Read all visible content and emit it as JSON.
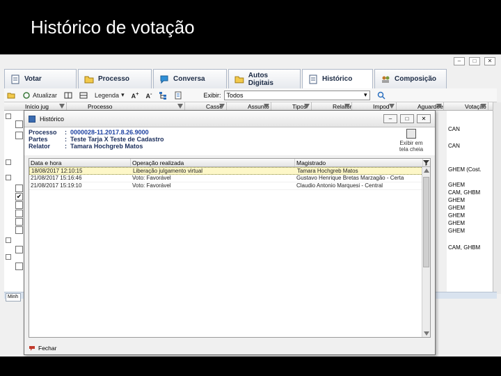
{
  "slide": {
    "title": "Histórico de votação"
  },
  "app": {
    "window_controls": [
      "–",
      "□",
      "✕"
    ],
    "tabs": [
      {
        "label": "Votar",
        "icon": "document-icon"
      },
      {
        "label": "Processo",
        "icon": "folder-icon"
      },
      {
        "label": "Conversa",
        "icon": "chat-bubble-icon"
      },
      {
        "label": "Autos Digitais",
        "icon": "folder-icon"
      },
      {
        "label": "Histórico",
        "icon": "document-icon"
      },
      {
        "label": "Composição",
        "icon": "people-icon"
      }
    ],
    "toolbar": {
      "atualizar": "Atualizar",
      "legenda": "Legenda",
      "exibir_label": "Exibir:",
      "exibir_value": "Todos"
    },
    "grid_columns": [
      "Início jug",
      "Processo",
      "Casse",
      "Assunto",
      "Tipos",
      "Relator",
      "Impod",
      "Aguardeed",
      "Votação"
    ],
    "right_col_values": [
      "CAN",
      "CAN",
      "GHEM (Cost.",
      "GHEM",
      "CAM, GHBM",
      "GHEM",
      "GHEM",
      "GHEM",
      "GHEM",
      "GHEM",
      "CAM, GHBM"
    ],
    "bottom_tab": "Minh"
  },
  "dialog": {
    "title": "Histórico",
    "controls": [
      "–",
      "□",
      "✕"
    ],
    "info": {
      "processo_label": "Processo",
      "processo_value": "0000028-11.2017.8.26.9000",
      "partes_label": "Partes",
      "partes_value": "Teste Tarja X Teste de Cadastro",
      "relator_label": "Relator",
      "relator_value": "Tamara Hochgreb Matos"
    },
    "exhibit_label": "Exibir em tela cheia",
    "table": {
      "headers": [
        "Data e hora",
        "Operação realizada",
        "Magistrado"
      ],
      "rows": [
        {
          "date": "18/08/2017 12:10:15",
          "op": "Liberação julgamento virtual",
          "mag": "Tamara Hochgreb Matos",
          "selected": true
        },
        {
          "date": "21/08/2017 15:16:46",
          "op": "Voto: Favorável",
          "mag": "Gustavo Henrique Bretas Marzagão - Certa",
          "selected": false
        },
        {
          "date": "21/08/2017 15:19:10",
          "op": "Voto: Favorável",
          "mag": "Claudio Antonio Marquesi - Central",
          "selected": false
        }
      ]
    },
    "footer": {
      "fechar": "Fechar"
    }
  }
}
